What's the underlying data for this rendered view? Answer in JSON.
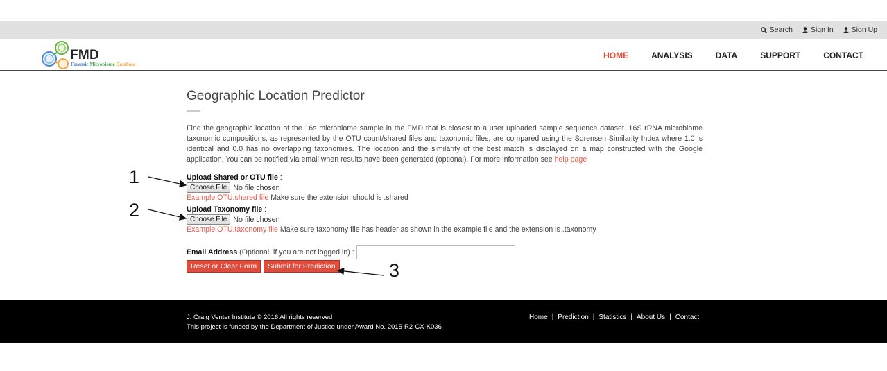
{
  "topbar": {
    "search": "Search",
    "sign_in": "Sign In",
    "sign_up": "Sign Up"
  },
  "logo": {
    "name": "FMD",
    "sub_forensic": "Forensic",
    "sub_microbiome": "Microbiome",
    "sub_database": "Database"
  },
  "nav": {
    "items": [
      "HOME",
      "ANALYSIS",
      "DATA",
      "SUPPORT",
      "CONTACT"
    ],
    "active": "HOME",
    "active_color": "#e14b3b"
  },
  "main": {
    "title": "Geographic Location Predictor",
    "description": "Find the geographic location of the 16s microbiome sample in the FMD that is closest to a user uploaded sample sequence dataset. 16S rRNA microbiome taxonomic compositions, as represented by the OTU count/shared files and taxonomic files, are compared using the Sorensen Similarity Index where 1.0 is identical and 0.0 has no overlapping taxonomies. The location and the similarity of the best match is displayed on a map constructed with the Google application. You can be notified via email when results have been generated (optional). For more information see",
    "help_link": "help page"
  },
  "form": {
    "shared_label": "Upload Shared or OTU file",
    "colon": " :",
    "choose_file": "Choose File",
    "no_file": "No file chosen",
    "shared_example_link": "Example OTU.shared file",
    "shared_hint": "Make sure the extension should is .shared",
    "taxonomy_label": "Upload Taxonomy file",
    "taxonomy_example_link": "Example OTU.taxonomy file",
    "taxonomy_hint": "Make sure taxonomy file has header as shown in the example file and the extension is .taxonomy",
    "email_label": "Email Address",
    "email_note": "(Optional, if you are not logged in) :",
    "email_value": "",
    "reset_button": "Reset or Clear Form",
    "submit_button": "Submit for Prediction"
  },
  "annotations": [
    "1",
    "2",
    "3"
  ],
  "footer": {
    "copyright": "J. Craig Venter Institute © 2016 All rights reserved",
    "funding": "This project is funded by the Department of Justice under Award No. 2015-R2-CX-K036",
    "links": [
      "Home",
      "Prediction",
      "Statistics",
      "About Us",
      "Contact"
    ]
  },
  "colors": {
    "accent": "#e14b3b",
    "link": "#e25b4b",
    "topbar_bg": "#e1e1e1",
    "footer_bg": "#000000"
  }
}
